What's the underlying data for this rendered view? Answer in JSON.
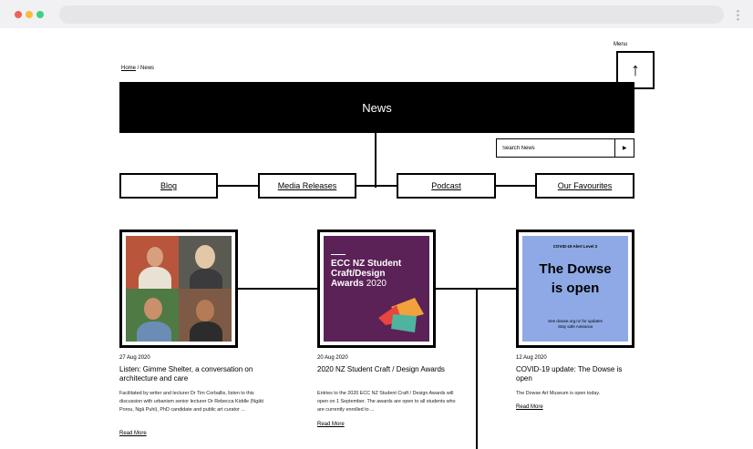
{
  "breadcrumb": {
    "home": "Home",
    "separator": " / ",
    "current": "News"
  },
  "menu": {
    "label": "Menu",
    "icon": "↑"
  },
  "banner": {
    "title": "News"
  },
  "search": {
    "placeholder": "Search News",
    "button": "▶"
  },
  "categories": [
    {
      "label": "Blog"
    },
    {
      "label": "Media Releases"
    },
    {
      "label": "Podcast"
    },
    {
      "label": "Our Favourites"
    }
  ],
  "articles": [
    {
      "date": "27 Aug 2020",
      "title": "Listen: Gimme Shelter, a conversation on architecture and care",
      "excerpt": "Facilitated by writer and lecturer Dr Tim Corballis, listen to this discussion with urbanism senior lecturer Dr Rebecca Kiddle (Ngāti Porou, Ngā Puhi), PhD candidate and public art curator ...",
      "read_more": "Read More"
    },
    {
      "date": "20 Aug 2020",
      "title": "2020 NZ Student Craft / Design Awards",
      "excerpt": "Entries to the 2020 ECC NZ Student Craft / Design Awards will open on 1 September. The awards are open to all students who are currently enrolled to ...",
      "read_more": "Read More",
      "image_text": {
        "line1": "ECC NZ Student",
        "line2": "Craft/Design",
        "line3": "Awards",
        "year": "2020"
      }
    },
    {
      "date": "12 Aug 2020",
      "title": "COVID-19 update: The Dowse is open",
      "excerpt": "The Dowse Art Museum is open today.",
      "read_more": "Read More",
      "image_text": {
        "top": "COVID-19 Alert Level 2",
        "big1": "The Dowse",
        "big2": "is open",
        "foot1": "See dowse.org.nz for updates",
        "foot2": "Stay safe Aotearoa"
      }
    }
  ],
  "colors": {
    "ecc_purple": "#5b2257",
    "dowse_blue": "#8ea9e6",
    "black": "#000000"
  }
}
